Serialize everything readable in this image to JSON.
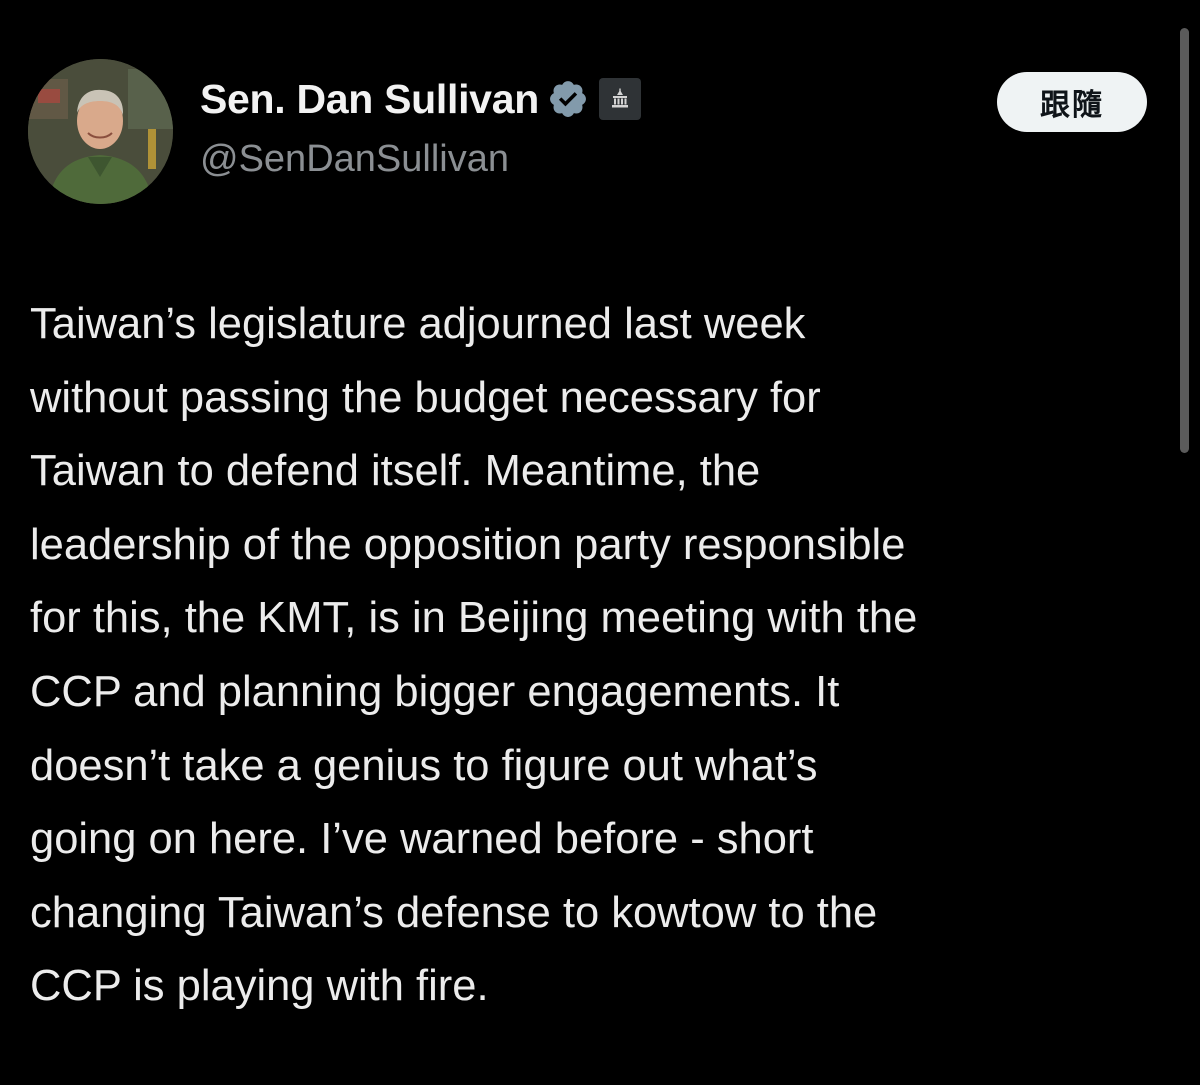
{
  "author": {
    "display_name": "Sen. Dan Sullivan",
    "handle": "@SenDanSullivan",
    "avatar_icon": "person-avatar",
    "verified_icon": "verified-badge-icon",
    "affiliation_icon": "government-building-icon"
  },
  "follow_button": {
    "label": "跟隨"
  },
  "tweet": {
    "lines": [
      "Taiwan’s legislature adjourned last week",
      "without passing the budget necessary for",
      "Taiwan to defend itself. Meantime, the",
      "leadership of the opposition party responsible",
      "for this, the KMT, is in Beijing meeting with the",
      "CCP and planning bigger engagements. It",
      "doesn’t take a genius to figure out what’s",
      "going on here. I’ve warned before - short",
      "changing Taiwan’s defense to kowtow to the",
      "CCP is playing with fire."
    ]
  },
  "colors": {
    "background": "#000000",
    "text": "#e7e9ea",
    "secondary_text": "#8b8f93",
    "verified_badge": "#829aab",
    "follow_button_bg": "#eff3f4"
  }
}
